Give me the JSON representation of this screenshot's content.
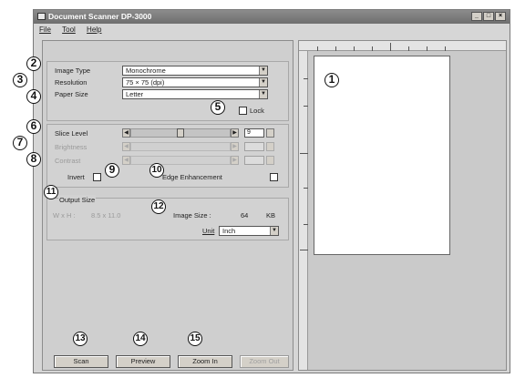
{
  "window": {
    "title": "Document Scanner  DP-3000",
    "min_glyph": "_",
    "max_glyph": "□",
    "close_glyph": "×"
  },
  "menu": [
    {
      "label": "File"
    },
    {
      "label": "Tool"
    },
    {
      "label": "Help"
    }
  ],
  "scan_settings": {
    "image_type_label": "Image Type",
    "image_type_value": "Monochrome",
    "resolution_label": "Resolution",
    "resolution_value": "75 × 75 (dpi)",
    "paper_size_label": "Paper Size",
    "paper_size_value": "Letter",
    "lock_label": "Lock"
  },
  "adjustments": {
    "slice_level_label": "Slice Level",
    "slice_level_value": "9",
    "slice_level_fraction": 0.5,
    "brightness_label": "Brightness",
    "contrast_label": "Contrast",
    "invert_label": "Invert",
    "edge_enhancement_label": "Edge Enhancement"
  },
  "output": {
    "section_label": "Output Size",
    "wh_label": "W x H :",
    "wh_value": "8.5 x 11.0",
    "image_size_label": "Image Size :",
    "image_size_value": "64",
    "image_size_unit": "KB",
    "unit_label": "Unit",
    "unit_value": "Inch"
  },
  "buttons": {
    "scan": "Scan",
    "preview": "Preview",
    "zoom_in": "Zoom In",
    "zoom_out": "Zoom Out"
  },
  "callouts": [
    "1",
    "2",
    "3",
    "4",
    "5",
    "6",
    "7",
    "8",
    "9",
    "10",
    "11",
    "12",
    "13",
    "14",
    "15"
  ],
  "icons": {
    "dropdown": "▼",
    "left_arrow": "◀",
    "right_arrow": "▶"
  }
}
